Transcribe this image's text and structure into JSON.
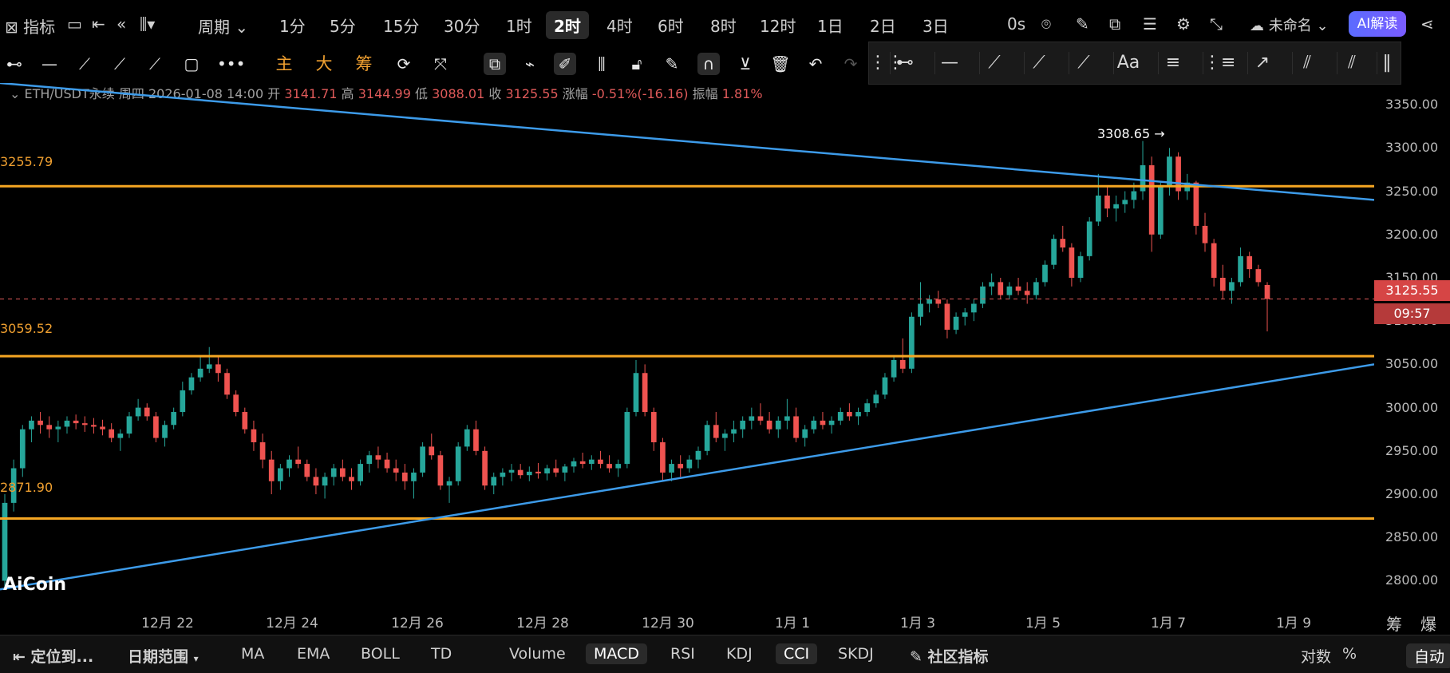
{
  "topbar": {
    "indicator_label": "指标",
    "period_label": "周期",
    "timeframes": [
      "1分",
      "5分",
      "15分",
      "30分",
      "1时",
      "2时",
      "4时",
      "6时",
      "8时",
      "12时",
      "1日",
      "2日",
      "3日"
    ],
    "active_timeframe": "2时",
    "latency": "0s",
    "layout_name": "未命名",
    "ai_button": "AI解读"
  },
  "toolbar": {
    "main_label": "主",
    "large_label": "大",
    "chip_label": "筹"
  },
  "info": {
    "symbol": "ETH/USDT永续",
    "weekday": "周四",
    "datetime": "2026-01-08 14:00",
    "open_label": "开",
    "open": "3141.71",
    "high_label": "高",
    "high": "3144.99",
    "low_label": "低",
    "low": "3088.01",
    "close_label": "收",
    "close": "3125.55",
    "change_label": "涨幅",
    "change": "-0.51%(-16.16)",
    "amplitude_label": "振幅",
    "amplitude": "1.81%"
  },
  "price_axis": [
    "3350.00",
    "3300.00",
    "3250.00",
    "3200.00",
    "3150.00",
    "3100.00",
    "3050.00",
    "3000.00",
    "2950.00",
    "2900.00",
    "2850.00",
    "2800.00"
  ],
  "current_price": "3125.55",
  "countdown": "09:57",
  "time_axis": [
    "12月 22",
    "12月 24",
    "12月 26",
    "12月 28",
    "12月 30",
    "1月 1",
    "1月 3",
    "1月 5",
    "1月 7",
    "1月 9"
  ],
  "right_axis_ctrl": {
    "chip": "筹",
    "burst": "爆"
  },
  "horizontal_levels": {
    "level1": "3255.79",
    "level2": "3059.52",
    "level3": "2871.90"
  },
  "peak_label": "3308.65 →",
  "logo": "AiCoin",
  "bottombar": {
    "locate": "定位到...",
    "date_range": "日期范围",
    "overlays": [
      "MA",
      "EMA",
      "BOLL",
      "TD"
    ],
    "subcharts": [
      "Volume",
      "MACD",
      "RSI",
      "KDJ",
      "CCI",
      "SKDJ"
    ],
    "community": "社区指标",
    "log": "对数",
    "percent": "%",
    "auto": "自动"
  },
  "chart_data": {
    "type": "candlestick",
    "title": "ETH/USDT永续",
    "ylim": [
      2770,
      3375
    ],
    "levels": [
      3255.79,
      3059.52,
      2871.9
    ],
    "colors": {
      "up": "#26a69a",
      "down": "#ef5350",
      "level": "#f5a623",
      "trend": "#3d9be9"
    },
    "trendlines": [
      {
        "from": [
          "12月 20",
          3375
        ],
        "to": [
          "1月 9",
          3240
        ]
      },
      {
        "from": [
          "12月 20",
          2790
        ],
        "to": [
          "1月 9",
          3050
        ]
      }
    ],
    "candles": [
      [
        2800,
        2900,
        2790,
        2890
      ],
      [
        2890,
        2940,
        2880,
        2930
      ],
      [
        2930,
        2980,
        2920,
        2975
      ],
      [
        2975,
        2990,
        2960,
        2985
      ],
      [
        2985,
        2995,
        2970,
        2980
      ],
      [
        2980,
        2990,
        2965,
        2975
      ],
      [
        2975,
        2985,
        2960,
        2978
      ],
      [
        2978,
        2990,
        2970,
        2985
      ],
      [
        2985,
        2992,
        2975,
        2982
      ],
      [
        2982,
        2990,
        2972,
        2980
      ],
      [
        2980,
        2988,
        2970,
        2978
      ],
      [
        2978,
        2986,
        2968,
        2975
      ],
      [
        2975,
        2982,
        2960,
        2965
      ],
      [
        2965,
        2975,
        2950,
        2970
      ],
      [
        2970,
        2995,
        2965,
        2990
      ],
      [
        2990,
        3010,
        2985,
        3000
      ],
      [
        3000,
        3005,
        2985,
        2990
      ],
      [
        2990,
        2995,
        2960,
        2965
      ],
      [
        2965,
        2985,
        2955,
        2980
      ],
      [
        2980,
        3000,
        2975,
        2995
      ],
      [
        2995,
        3030,
        2990,
        3020
      ],
      [
        3020,
        3040,
        3015,
        3035
      ],
      [
        3035,
        3060,
        3030,
        3045
      ],
      [
        3045,
        3070,
        3040,
        3050
      ],
      [
        3050,
        3060,
        3030,
        3040
      ],
      [
        3040,
        3045,
        3010,
        3015
      ],
      [
        3015,
        3020,
        2990,
        2995
      ],
      [
        2995,
        3000,
        2970,
        2975
      ],
      [
        2975,
        2985,
        2950,
        2960
      ],
      [
        2960,
        2970,
        2930,
        2940
      ],
      [
        2940,
        2950,
        2900,
        2915
      ],
      [
        2915,
        2935,
        2905,
        2930
      ],
      [
        2930,
        2945,
        2920,
        2940
      ],
      [
        2940,
        2955,
        2930,
        2935
      ],
      [
        2935,
        2940,
        2915,
        2920
      ],
      [
        2920,
        2930,
        2900,
        2910
      ],
      [
        2910,
        2925,
        2895,
        2920
      ],
      [
        2920,
        2935,
        2910,
        2930
      ],
      [
        2930,
        2940,
        2915,
        2920
      ],
      [
        2920,
        2930,
        2905,
        2915
      ],
      [
        2915,
        2940,
        2910,
        2935
      ],
      [
        2935,
        2950,
        2925,
        2945
      ],
      [
        2945,
        2955,
        2930,
        2940
      ],
      [
        2940,
        2948,
        2925,
        2930
      ],
      [
        2930,
        2940,
        2915,
        2925
      ],
      [
        2925,
        2935,
        2905,
        2915
      ],
      [
        2915,
        2930,
        2895,
        2925
      ],
      [
        2925,
        2960,
        2920,
        2955
      ],
      [
        2955,
        2970,
        2940,
        2945
      ],
      [
        2945,
        2950,
        2905,
        2910
      ],
      [
        2910,
        2920,
        2890,
        2915
      ],
      [
        2915,
        2960,
        2910,
        2955
      ],
      [
        2955,
        2980,
        2950,
        2975
      ],
      [
        2975,
        2985,
        2945,
        2950
      ],
      [
        2950,
        2955,
        2905,
        2910
      ],
      [
        2910,
        2925,
        2900,
        2920
      ],
      [
        2920,
        2930,
        2910,
        2925
      ],
      [
        2925,
        2935,
        2915,
        2928
      ],
      [
        2928,
        2935,
        2918,
        2922
      ],
      [
        2922,
        2932,
        2915,
        2926
      ],
      [
        2926,
        2936,
        2918,
        2924
      ],
      [
        2924,
        2934,
        2916,
        2930
      ],
      [
        2930,
        2940,
        2920,
        2925
      ],
      [
        2925,
        2935,
        2915,
        2932
      ],
      [
        2932,
        2942,
        2925,
        2938
      ],
      [
        2938,
        2948,
        2930,
        2935
      ],
      [
        2935,
        2945,
        2928,
        2940
      ],
      [
        2940,
        2950,
        2930,
        2935
      ],
      [
        2935,
        2945,
        2925,
        2930
      ],
      [
        2930,
        2940,
        2920,
        2935
      ],
      [
        2935,
        3000,
        2930,
        2995
      ],
      [
        2995,
        3055,
        2990,
        3040
      ],
      [
        3040,
        3050,
        2990,
        2995
      ],
      [
        2995,
        3000,
        2950,
        2960
      ],
      [
        2960,
        2965,
        2915,
        2925
      ],
      [
        2925,
        2940,
        2915,
        2935
      ],
      [
        2935,
        2945,
        2920,
        2930
      ],
      [
        2930,
        2945,
        2925,
        2940
      ],
      [
        2940,
        2955,
        2930,
        2950
      ],
      [
        2950,
        2985,
        2945,
        2980
      ],
      [
        2980,
        2995,
        2960,
        2965
      ],
      [
        2965,
        2975,
        2950,
        2970
      ],
      [
        2970,
        2985,
        2960,
        2975
      ],
      [
        2975,
        2990,
        2965,
        2985
      ],
      [
        2985,
        3000,
        2975,
        2990
      ],
      [
        2990,
        3005,
        2980,
        2985
      ],
      [
        2985,
        2995,
        2970,
        2975
      ],
      [
        2975,
        2990,
        2965,
        2985
      ],
      [
        2985,
        3010,
        2975,
        2990
      ],
      [
        2990,
        3000,
        2960,
        2965
      ],
      [
        2965,
        2980,
        2955,
        2975
      ],
      [
        2975,
        2990,
        2970,
        2985
      ],
      [
        2985,
        2995,
        2975,
        2980
      ],
      [
        2980,
        2990,
        2970,
        2985
      ],
      [
        2985,
        3000,
        2980,
        2995
      ],
      [
        2995,
        3005,
        2985,
        2990
      ],
      [
        2990,
        3000,
        2980,
        2995
      ],
      [
        2995,
        3010,
        2990,
        3005
      ],
      [
        3005,
        3020,
        3000,
        3015
      ],
      [
        3015,
        3040,
        3010,
        3035
      ],
      [
        3035,
        3060,
        3030,
        3055
      ],
      [
        3055,
        3080,
        3040,
        3045
      ],
      [
        3045,
        3110,
        3040,
        3105
      ],
      [
        3105,
        3145,
        3095,
        3120
      ],
      [
        3120,
        3130,
        3110,
        3125
      ],
      [
        3125,
        3135,
        3115,
        3120
      ],
      [
        3120,
        3125,
        3080,
        3090
      ],
      [
        3090,
        3110,
        3085,
        3105
      ],
      [
        3105,
        3115,
        3095,
        3110
      ],
      [
        3110,
        3125,
        3100,
        3120
      ],
      [
        3120,
        3145,
        3115,
        3140
      ],
      [
        3140,
        3155,
        3130,
        3145
      ],
      [
        3145,
        3150,
        3125,
        3130
      ],
      [
        3130,
        3145,
        3125,
        3140
      ],
      [
        3140,
        3150,
        3130,
        3135
      ],
      [
        3135,
        3145,
        3120,
        3130
      ],
      [
        3130,
        3150,
        3125,
        3145
      ],
      [
        3145,
        3170,
        3140,
        3165
      ],
      [
        3165,
        3200,
        3160,
        3195
      ],
      [
        3195,
        3210,
        3180,
        3185
      ],
      [
        3185,
        3190,
        3140,
        3150
      ],
      [
        3150,
        3180,
        3145,
        3175
      ],
      [
        3175,
        3220,
        3170,
        3215
      ],
      [
        3215,
        3270,
        3210,
        3245
      ],
      [
        3245,
        3255,
        3220,
        3230
      ],
      [
        3230,
        3245,
        3215,
        3235
      ],
      [
        3235,
        3250,
        3225,
        3240
      ],
      [
        3240,
        3260,
        3230,
        3250
      ],
      [
        3250,
        3308,
        3240,
        3280
      ],
      [
        3280,
        3290,
        3180,
        3200
      ],
      [
        3200,
        3260,
        3195,
        3255
      ],
      [
        3255,
        3300,
        3245,
        3290
      ],
      [
        3290,
        3295,
        3240,
        3250
      ],
      [
        3250,
        3270,
        3240,
        3260
      ],
      [
        3260,
        3262,
        3200,
        3210
      ],
      [
        3210,
        3225,
        3180,
        3190
      ],
      [
        3190,
        3195,
        3140,
        3150
      ],
      [
        3150,
        3165,
        3125,
        3135
      ],
      [
        3135,
        3150,
        3120,
        3145
      ],
      [
        3145,
        3185,
        3140,
        3175
      ],
      [
        3175,
        3180,
        3150,
        3160
      ],
      [
        3160,
        3165,
        3140,
        3145
      ],
      [
        3141.71,
        3144.99,
        3088.01,
        3125.55
      ]
    ]
  }
}
